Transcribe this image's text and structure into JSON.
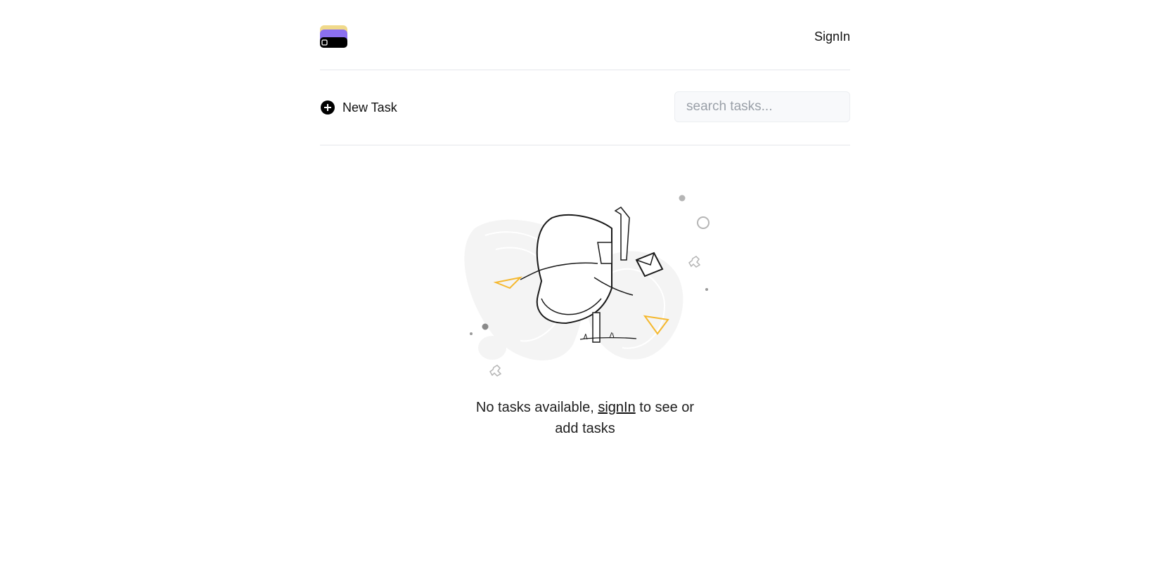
{
  "header": {
    "logo_name": "app-logo",
    "signin_label": "SignIn"
  },
  "toolbar": {
    "new_task_label": "New Task",
    "search_placeholder": "search tasks..."
  },
  "empty_state": {
    "message_before": "No tasks available, ",
    "signin_link": "signIn",
    "message_after": " to see or add tasks"
  },
  "colors": {
    "accent_purple": "#8b6ff0",
    "accent_yellow": "#f0d98a",
    "illustration_orange": "#f5b82e",
    "border": "#e5e7eb"
  }
}
